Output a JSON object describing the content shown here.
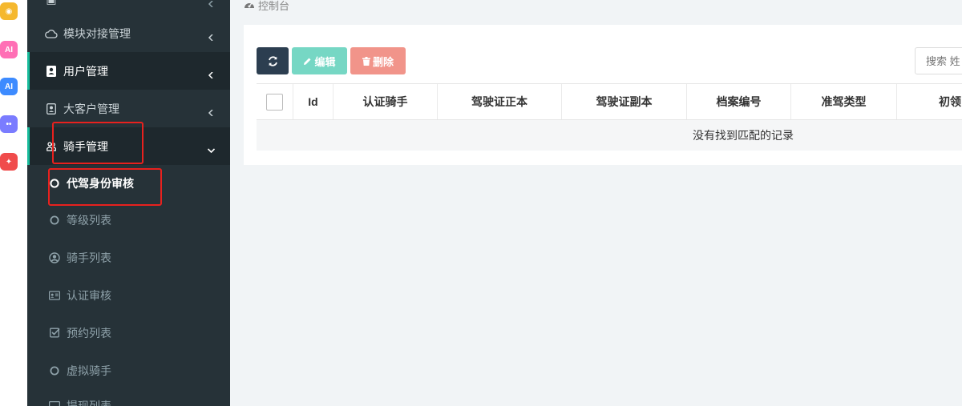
{
  "dock": {
    "icons": [
      {
        "name": "robot-app-icon",
        "color": "#f5b82e",
        "glyph": "◉"
      },
      {
        "name": "ai-ring-app-icon",
        "color": "#ff6fb5",
        "glyph": "AI"
      },
      {
        "name": "ai-blue-app-icon",
        "color": "#3d8bff",
        "glyph": "AI"
      },
      {
        "name": "chat-bot-app-icon",
        "color": "#7a7cff",
        "glyph": "••"
      },
      {
        "name": "game-app-icon",
        "color": "#f04c4c",
        "glyph": "✦"
      }
    ]
  },
  "sidebar": {
    "top_items": [
      {
        "label": "模块对接管理",
        "icon": "cloud-icon",
        "glyph": "☁",
        "state": "collapsed"
      },
      {
        "label": "用户管理",
        "icon": "user-card-icon",
        "glyph": "▣",
        "state": "active-collapsed"
      },
      {
        "label": "大客户管理",
        "icon": "portrait-icon",
        "glyph": "◙",
        "state": "collapsed"
      },
      {
        "label": "骑手管理",
        "icon": "users-icon",
        "glyph": "♙",
        "state": "expanded"
      }
    ],
    "sub_items": [
      {
        "label": "代驾身份审核",
        "icon": "circle-icon",
        "glyph": "○",
        "current": true
      },
      {
        "label": "等级列表",
        "icon": "circle-icon",
        "glyph": "○",
        "current": false
      },
      {
        "label": "骑手列表",
        "icon": "user-circle-icon",
        "glyph": "◉",
        "current": false
      },
      {
        "label": "认证审核",
        "icon": "id-card-icon",
        "glyph": "▤",
        "current": false
      },
      {
        "label": "预约列表",
        "icon": "check-square-icon",
        "glyph": "☑",
        "current": false
      },
      {
        "label": "虚拟骑手",
        "icon": "circle-icon",
        "glyph": "○",
        "current": false
      }
    ],
    "partial_bottom_label": "提现列表"
  },
  "breadcrumb": {
    "icon": "dashboard-icon",
    "label": "控制台"
  },
  "toolbar": {
    "refresh_icon": "refresh-icon",
    "edit_label": "编辑",
    "delete_label": "删除",
    "search_placeholder": "搜索 姓"
  },
  "table": {
    "columns": [
      "Id",
      "认证骑手",
      "驾驶证正本",
      "驾驶证副本",
      "档案编号",
      "准驾类型",
      "初领"
    ],
    "empty_message": "没有找到匹配的记录"
  },
  "colors": {
    "sidebar_bg": "#263238",
    "sidebar_active_bg": "#1e282d",
    "accent_green": "#18bc9c",
    "refresh_btn": "#2c3e50",
    "edit_btn": "#76d7c4",
    "delete_btn": "#f1948a",
    "highlight_red": "#e8211e"
  }
}
